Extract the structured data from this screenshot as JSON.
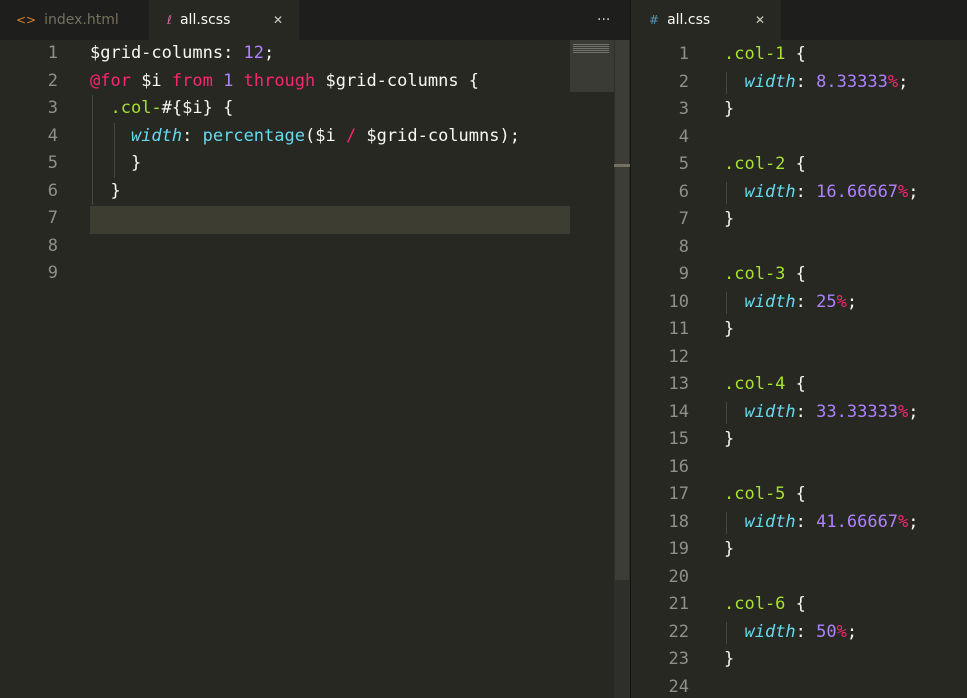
{
  "left_tabs": [
    {
      "icon": "<>",
      "label": "index.html"
    },
    {
      "icon": "ℓ",
      "label": "all.scss",
      "close": "✕"
    }
  ],
  "left_overflow": "···",
  "right_tab": {
    "icon": "#",
    "label": "all.css",
    "close": "✕"
  },
  "left_editor": {
    "lines": [
      {
        "n": "1",
        "tokens": [
          {
            "t": "$grid-columns",
            "c": "var"
          },
          {
            "t": ": ",
            "c": "plain"
          },
          {
            "t": "12",
            "c": "num"
          },
          {
            "t": ";",
            "c": "plain"
          }
        ]
      },
      {
        "n": "2",
        "tokens": [
          {
            "t": "@for",
            "c": "kw"
          },
          {
            "t": " $i ",
            "c": "var"
          },
          {
            "t": "from",
            "c": "kw"
          },
          {
            "t": " ",
            "c": "plain"
          },
          {
            "t": "1",
            "c": "num"
          },
          {
            "t": " ",
            "c": "plain"
          },
          {
            "t": "through",
            "c": "kw"
          },
          {
            "t": " $grid-columns {",
            "c": "var"
          }
        ]
      },
      {
        "n": "3",
        "tokens": [
          {
            "t": "  ",
            "c": "plain"
          },
          {
            "t": ".col-",
            "c": "sel"
          },
          {
            "t": "#{$i} {",
            "c": "plain"
          }
        ]
      },
      {
        "n": "4",
        "tokens": [
          {
            "t": "    ",
            "c": "plain"
          },
          {
            "t": "width",
            "c": "prop"
          },
          {
            "t": ": ",
            "c": "plain"
          },
          {
            "t": "percentage",
            "c": "fn"
          },
          {
            "t": "($i ",
            "c": "plain"
          },
          {
            "t": "/",
            "c": "kw"
          },
          {
            "t": " $grid-columns);",
            "c": "plain"
          }
        ]
      },
      {
        "n": "5",
        "tokens": [
          {
            "t": "    }",
            "c": "plain"
          }
        ]
      },
      {
        "n": "6",
        "tokens": [
          {
            "t": "  }",
            "c": "plain"
          }
        ]
      },
      {
        "n": "7",
        "tokens": []
      },
      {
        "n": "8",
        "tokens": []
      },
      {
        "n": "9",
        "tokens": []
      }
    ]
  },
  "right_editor": {
    "lines": [
      {
        "n": "1",
        "tokens": [
          {
            "t": ".col-1",
            "c": "sel"
          },
          {
            "t": " {",
            "c": "plain"
          }
        ]
      },
      {
        "n": "2",
        "tokens": [
          {
            "t": "  ",
            "c": "plain"
          },
          {
            "t": "width",
            "c": "prop"
          },
          {
            "t": ": ",
            "c": "plain"
          },
          {
            "t": "8.33333",
            "c": "num"
          },
          {
            "t": "%",
            "c": "pct"
          },
          {
            "t": ";",
            "c": "plain"
          }
        ]
      },
      {
        "n": "3",
        "tokens": [
          {
            "t": "}",
            "c": "plain"
          }
        ]
      },
      {
        "n": "4",
        "tokens": []
      },
      {
        "n": "5",
        "tokens": [
          {
            "t": ".col-2",
            "c": "sel"
          },
          {
            "t": " {",
            "c": "plain"
          }
        ]
      },
      {
        "n": "6",
        "tokens": [
          {
            "t": "  ",
            "c": "plain"
          },
          {
            "t": "width",
            "c": "prop"
          },
          {
            "t": ": ",
            "c": "plain"
          },
          {
            "t": "16.66667",
            "c": "num"
          },
          {
            "t": "%",
            "c": "pct"
          },
          {
            "t": ";",
            "c": "plain"
          }
        ]
      },
      {
        "n": "7",
        "tokens": [
          {
            "t": "}",
            "c": "plain"
          }
        ]
      },
      {
        "n": "8",
        "tokens": []
      },
      {
        "n": "9",
        "tokens": [
          {
            "t": ".col-3",
            "c": "sel"
          },
          {
            "t": " {",
            "c": "plain"
          }
        ]
      },
      {
        "n": "10",
        "tokens": [
          {
            "t": "  ",
            "c": "plain"
          },
          {
            "t": "width",
            "c": "prop"
          },
          {
            "t": ": ",
            "c": "plain"
          },
          {
            "t": "25",
            "c": "num"
          },
          {
            "t": "%",
            "c": "pct"
          },
          {
            "t": ";",
            "c": "plain"
          }
        ]
      },
      {
        "n": "11",
        "tokens": [
          {
            "t": "}",
            "c": "plain"
          }
        ]
      },
      {
        "n": "12",
        "tokens": []
      },
      {
        "n": "13",
        "tokens": [
          {
            "t": ".col-4",
            "c": "sel"
          },
          {
            "t": " {",
            "c": "plain"
          }
        ]
      },
      {
        "n": "14",
        "tokens": [
          {
            "t": "  ",
            "c": "plain"
          },
          {
            "t": "width",
            "c": "prop"
          },
          {
            "t": ": ",
            "c": "plain"
          },
          {
            "t": "33.33333",
            "c": "num"
          },
          {
            "t": "%",
            "c": "pct"
          },
          {
            "t": ";",
            "c": "plain"
          }
        ]
      },
      {
        "n": "15",
        "tokens": [
          {
            "t": "}",
            "c": "plain"
          }
        ]
      },
      {
        "n": "16",
        "tokens": []
      },
      {
        "n": "17",
        "tokens": [
          {
            "t": ".col-5",
            "c": "sel"
          },
          {
            "t": " {",
            "c": "plain"
          }
        ]
      },
      {
        "n": "18",
        "tokens": [
          {
            "t": "  ",
            "c": "plain"
          },
          {
            "t": "width",
            "c": "prop"
          },
          {
            "t": ": ",
            "c": "plain"
          },
          {
            "t": "41.66667",
            "c": "num"
          },
          {
            "t": "%",
            "c": "pct"
          },
          {
            "t": ";",
            "c": "plain"
          }
        ]
      },
      {
        "n": "19",
        "tokens": [
          {
            "t": "}",
            "c": "plain"
          }
        ]
      },
      {
        "n": "20",
        "tokens": []
      },
      {
        "n": "21",
        "tokens": [
          {
            "t": ".col-6",
            "c": "sel"
          },
          {
            "t": " {",
            "c": "plain"
          }
        ]
      },
      {
        "n": "22",
        "tokens": [
          {
            "t": "  ",
            "c": "plain"
          },
          {
            "t": "width",
            "c": "prop"
          },
          {
            "t": ": ",
            "c": "plain"
          },
          {
            "t": "50",
            "c": "num"
          },
          {
            "t": "%",
            "c": "pct"
          },
          {
            "t": ";",
            "c": "plain"
          }
        ]
      },
      {
        "n": "23",
        "tokens": [
          {
            "t": "}",
            "c": "plain"
          }
        ]
      },
      {
        "n": "24",
        "tokens": []
      }
    ]
  },
  "colors": {
    "background": "#272822",
    "tabbar": "#1e1f1c",
    "keyword": "#f92672",
    "number": "#ae81ff",
    "selector": "#a6e22e",
    "property": "#66d9ef",
    "text": "#f8f8f2",
    "line_number": "#90908a",
    "current_line": "#3e3d32"
  }
}
